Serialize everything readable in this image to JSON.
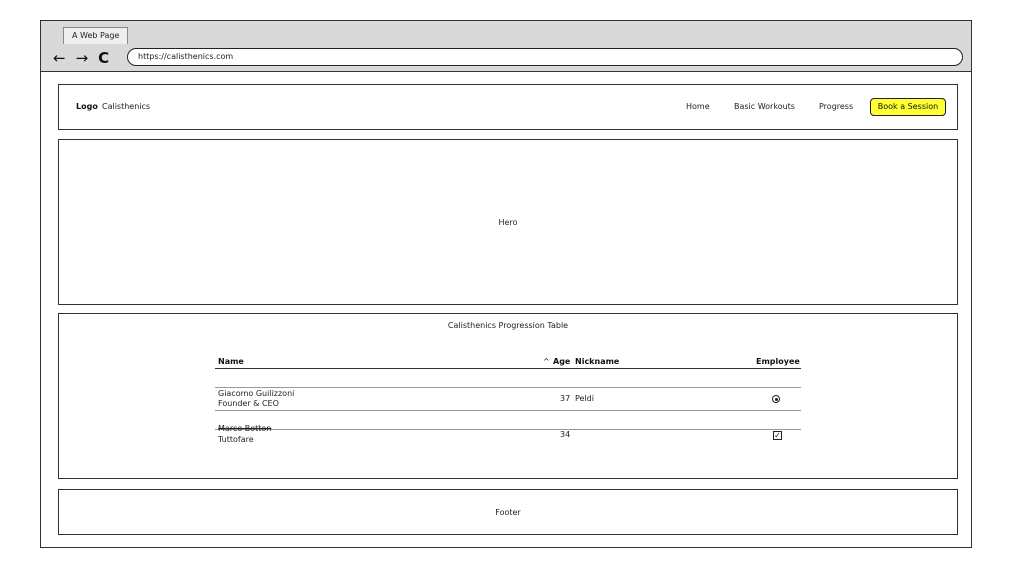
{
  "browser": {
    "tab_title": "A Web Page",
    "back_icon": "←",
    "forward_icon": "→",
    "reload_icon": "C",
    "url": "https://calisthenics.com"
  },
  "header": {
    "logo": "Logo",
    "brand": "Calisthenics",
    "nav": [
      "Home",
      "Basic Workouts",
      "Progress"
    ],
    "cta": "Book a Session",
    "cta_color": "#ffff33"
  },
  "hero": {
    "label": "Hero"
  },
  "table": {
    "title": "Calisthenics Progression Table",
    "columns": {
      "name": "Name",
      "age": "Age",
      "nickname": "Nickname",
      "employee": "Employee",
      "sort_icon": "^"
    },
    "rows": [
      {
        "name": "Giacomo Guilizzoni",
        "role": "Founder & CEO",
        "age": "37",
        "nickname": "Peldi",
        "employee": "radio-selected"
      },
      {
        "name": "Marco Botton",
        "role": "Tuttofare",
        "age": "34",
        "nickname": "",
        "employee": "checked"
      }
    ]
  },
  "footer": {
    "label": "Footer"
  }
}
